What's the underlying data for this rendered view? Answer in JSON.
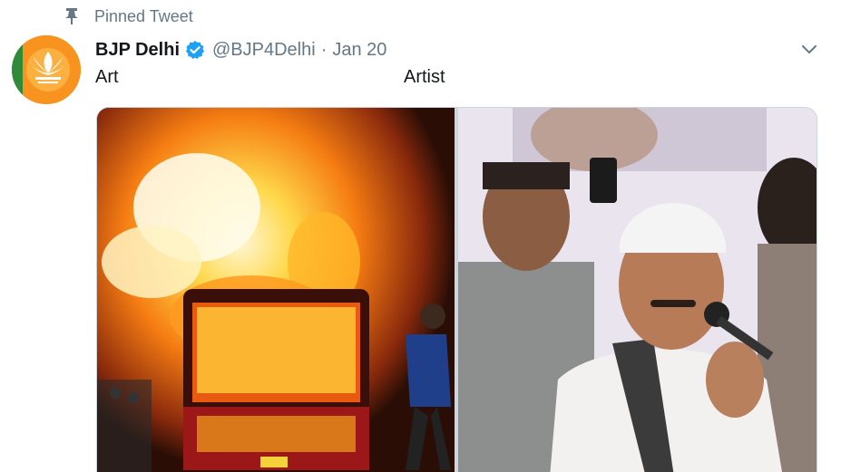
{
  "pinned": {
    "label": "Pinned Tweet",
    "icon": "pin-icon"
  },
  "tweet": {
    "display_name": "BJP Delhi",
    "verified_icon": "verified-badge-icon",
    "handle": "@BJP4Delhi",
    "separator": "·",
    "date": "Jan 20",
    "menu_icon": "chevron-down-icon",
    "text_left": "Art",
    "text_right": "Artist",
    "media": [
      {
        "name": "burning-bus-photo"
      },
      {
        "name": "man-speaking-into-microphone-photo"
      }
    ]
  },
  "colors": {
    "secondary_text": "#657786",
    "primary_text": "#14171a",
    "verified_blue": "#1da1f2",
    "avatar_orange": "#f7931e"
  }
}
